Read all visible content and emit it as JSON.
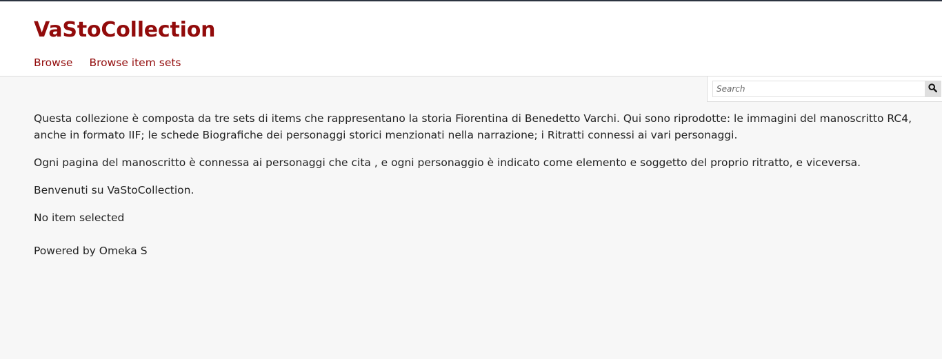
{
  "site": {
    "title": "VaStoCollection"
  },
  "nav": {
    "items": [
      {
        "label": "Browse"
      },
      {
        "label": "Browse item sets"
      }
    ]
  },
  "search": {
    "placeholder": "Search",
    "button_icon": "search-icon"
  },
  "content": {
    "paragraph_1": "Questa collezione è composta da tre sets di items che rappresentano la storia Fiorentina di Benedetto Varchi. Qui sono riprodotte: le immagini del manoscritto RC4, anche in formato IIF; le schede Biografiche dei personaggi storici menzionati nella narrazione; i Ritratti connessi ai vari personaggi.",
    "paragraph_2": "Ogni pagina del manoscritto è connessa ai personaggi che cita , e ogni personaggio è indicato come elemento e soggetto del proprio ritratto, e viceversa.",
    "paragraph_3": "Benvenuti su VaStoCollection.",
    "no_item": "No item selected"
  },
  "footer": {
    "text": "Powered by Omeka S"
  },
  "colors": {
    "accent": "#920b0b",
    "background": "#f7f7f7",
    "top_bar": "#2c3340"
  }
}
